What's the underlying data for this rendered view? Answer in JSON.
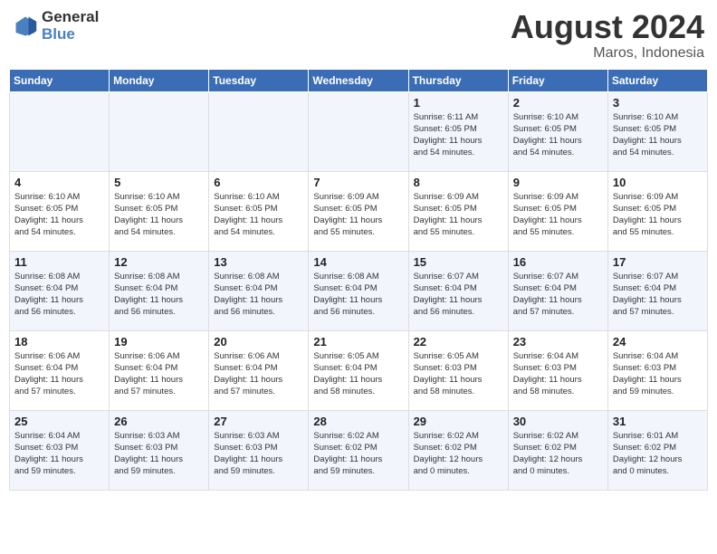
{
  "header": {
    "logo_general": "General",
    "logo_blue": "Blue",
    "month_year": "August 2024",
    "location": "Maros, Indonesia"
  },
  "weekdays": [
    "Sunday",
    "Monday",
    "Tuesday",
    "Wednesday",
    "Thursday",
    "Friday",
    "Saturday"
  ],
  "weeks": [
    [
      {
        "day": "",
        "info": ""
      },
      {
        "day": "",
        "info": ""
      },
      {
        "day": "",
        "info": ""
      },
      {
        "day": "",
        "info": ""
      },
      {
        "day": "1",
        "info": "Sunrise: 6:11 AM\nSunset: 6:05 PM\nDaylight: 11 hours\nand 54 minutes."
      },
      {
        "day": "2",
        "info": "Sunrise: 6:10 AM\nSunset: 6:05 PM\nDaylight: 11 hours\nand 54 minutes."
      },
      {
        "day": "3",
        "info": "Sunrise: 6:10 AM\nSunset: 6:05 PM\nDaylight: 11 hours\nand 54 minutes."
      }
    ],
    [
      {
        "day": "4",
        "info": "Sunrise: 6:10 AM\nSunset: 6:05 PM\nDaylight: 11 hours\nand 54 minutes."
      },
      {
        "day": "5",
        "info": "Sunrise: 6:10 AM\nSunset: 6:05 PM\nDaylight: 11 hours\nand 54 minutes."
      },
      {
        "day": "6",
        "info": "Sunrise: 6:10 AM\nSunset: 6:05 PM\nDaylight: 11 hours\nand 54 minutes."
      },
      {
        "day": "7",
        "info": "Sunrise: 6:09 AM\nSunset: 6:05 PM\nDaylight: 11 hours\nand 55 minutes."
      },
      {
        "day": "8",
        "info": "Sunrise: 6:09 AM\nSunset: 6:05 PM\nDaylight: 11 hours\nand 55 minutes."
      },
      {
        "day": "9",
        "info": "Sunrise: 6:09 AM\nSunset: 6:05 PM\nDaylight: 11 hours\nand 55 minutes."
      },
      {
        "day": "10",
        "info": "Sunrise: 6:09 AM\nSunset: 6:05 PM\nDaylight: 11 hours\nand 55 minutes."
      }
    ],
    [
      {
        "day": "11",
        "info": "Sunrise: 6:08 AM\nSunset: 6:04 PM\nDaylight: 11 hours\nand 56 minutes."
      },
      {
        "day": "12",
        "info": "Sunrise: 6:08 AM\nSunset: 6:04 PM\nDaylight: 11 hours\nand 56 minutes."
      },
      {
        "day": "13",
        "info": "Sunrise: 6:08 AM\nSunset: 6:04 PM\nDaylight: 11 hours\nand 56 minutes."
      },
      {
        "day": "14",
        "info": "Sunrise: 6:08 AM\nSunset: 6:04 PM\nDaylight: 11 hours\nand 56 minutes."
      },
      {
        "day": "15",
        "info": "Sunrise: 6:07 AM\nSunset: 6:04 PM\nDaylight: 11 hours\nand 56 minutes."
      },
      {
        "day": "16",
        "info": "Sunrise: 6:07 AM\nSunset: 6:04 PM\nDaylight: 11 hours\nand 57 minutes."
      },
      {
        "day": "17",
        "info": "Sunrise: 6:07 AM\nSunset: 6:04 PM\nDaylight: 11 hours\nand 57 minutes."
      }
    ],
    [
      {
        "day": "18",
        "info": "Sunrise: 6:06 AM\nSunset: 6:04 PM\nDaylight: 11 hours\nand 57 minutes."
      },
      {
        "day": "19",
        "info": "Sunrise: 6:06 AM\nSunset: 6:04 PM\nDaylight: 11 hours\nand 57 minutes."
      },
      {
        "day": "20",
        "info": "Sunrise: 6:06 AM\nSunset: 6:04 PM\nDaylight: 11 hours\nand 57 minutes."
      },
      {
        "day": "21",
        "info": "Sunrise: 6:05 AM\nSunset: 6:04 PM\nDaylight: 11 hours\nand 58 minutes."
      },
      {
        "day": "22",
        "info": "Sunrise: 6:05 AM\nSunset: 6:03 PM\nDaylight: 11 hours\nand 58 minutes."
      },
      {
        "day": "23",
        "info": "Sunrise: 6:04 AM\nSunset: 6:03 PM\nDaylight: 11 hours\nand 58 minutes."
      },
      {
        "day": "24",
        "info": "Sunrise: 6:04 AM\nSunset: 6:03 PM\nDaylight: 11 hours\nand 59 minutes."
      }
    ],
    [
      {
        "day": "25",
        "info": "Sunrise: 6:04 AM\nSunset: 6:03 PM\nDaylight: 11 hours\nand 59 minutes."
      },
      {
        "day": "26",
        "info": "Sunrise: 6:03 AM\nSunset: 6:03 PM\nDaylight: 11 hours\nand 59 minutes."
      },
      {
        "day": "27",
        "info": "Sunrise: 6:03 AM\nSunset: 6:03 PM\nDaylight: 11 hours\nand 59 minutes."
      },
      {
        "day": "28",
        "info": "Sunrise: 6:02 AM\nSunset: 6:02 PM\nDaylight: 11 hours\nand 59 minutes."
      },
      {
        "day": "29",
        "info": "Sunrise: 6:02 AM\nSunset: 6:02 PM\nDaylight: 12 hours\nand 0 minutes."
      },
      {
        "day": "30",
        "info": "Sunrise: 6:02 AM\nSunset: 6:02 PM\nDaylight: 12 hours\nand 0 minutes."
      },
      {
        "day": "31",
        "info": "Sunrise: 6:01 AM\nSunset: 6:02 PM\nDaylight: 12 hours\nand 0 minutes."
      }
    ]
  ]
}
